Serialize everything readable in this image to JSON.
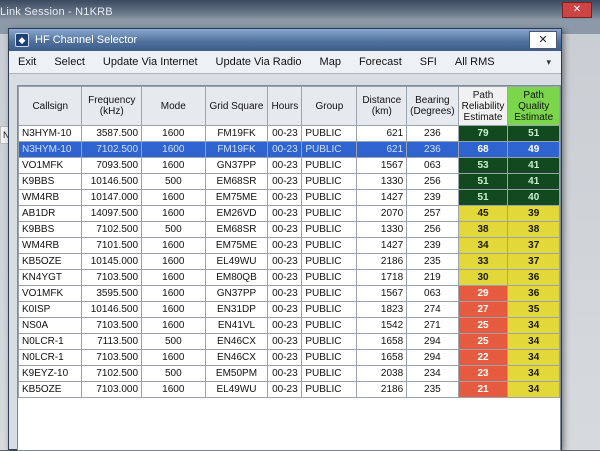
{
  "background": {
    "window_title": "Link Session - N1KRB",
    "close_glyph": "✕",
    "left_cell": "NO"
  },
  "window": {
    "title": "HF Channel Selector",
    "close_glyph": "✕",
    "menu": [
      "Exit",
      "Select",
      "Update Via Internet",
      "Update Via Radio",
      "Map",
      "Forecast",
      "SFI",
      "All RMS"
    ],
    "dropdown_icon": "▾"
  },
  "table": {
    "columns": [
      "Callsign",
      "Frequency (kHz)",
      "Mode",
      "Grid Square",
      "Hours",
      "Group",
      "Distance (km)",
      "Bearing (Degrees)",
      "Path Reliability Estimate",
      "Path Quality Estimate"
    ],
    "selected_row": 1,
    "rows": [
      [
        "N3HYM-10",
        "3587.500",
        "1600",
        "FM19FK",
        "00-23",
        "PUBLIC",
        "621",
        "236",
        "79",
        "51"
      ],
      [
        "N3HYM-10",
        "7102.500",
        "1600",
        "FM19FK",
        "00-23",
        "PUBLIC",
        "621",
        "236",
        "68",
        "49"
      ],
      [
        "VO1MFK",
        "7093.500",
        "1600",
        "GN37PP",
        "00-23",
        "PUBLIC",
        "1567",
        "063",
        "53",
        "41"
      ],
      [
        "K9BBS",
        "10146.500",
        "500",
        "EM68SR",
        "00-23",
        "PUBLIC",
        "1330",
        "256",
        "51",
        "41"
      ],
      [
        "WM4RB",
        "10147.000",
        "1600",
        "EM75ME",
        "00-23",
        "PUBLIC",
        "1427",
        "239",
        "51",
        "40"
      ],
      [
        "AB1DR",
        "14097.500",
        "1600",
        "EM26VD",
        "00-23",
        "PUBLIC",
        "2070",
        "257",
        "45",
        "39"
      ],
      [
        "K9BBS",
        "7102.500",
        "500",
        "EM68SR",
        "00-23",
        "PUBLIC",
        "1330",
        "256",
        "38",
        "38"
      ],
      [
        "WM4RB",
        "7101.500",
        "1600",
        "EM75ME",
        "00-23",
        "PUBLIC",
        "1427",
        "239",
        "34",
        "37"
      ],
      [
        "KB5OZE",
        "10145.000",
        "1600",
        "EL49WU",
        "00-23",
        "PUBLIC",
        "2186",
        "235",
        "33",
        "37"
      ],
      [
        "KN4YGT",
        "7103.500",
        "1600",
        "EM80QB",
        "00-23",
        "PUBLIC",
        "1718",
        "219",
        "30",
        "36"
      ],
      [
        "VO1MFK",
        "3595.500",
        "1600",
        "GN37PP",
        "00-23",
        "PUBLIC",
        "1567",
        "063",
        "29",
        "36"
      ],
      [
        "K0ISP",
        "10146.500",
        "1600",
        "EN31DP",
        "00-23",
        "PUBLIC",
        "1823",
        "274",
        "27",
        "35"
      ],
      [
        "NS0A",
        "7103.500",
        "1600",
        "EN41VL",
        "00-23",
        "PUBLIC",
        "1542",
        "271",
        "25",
        "34"
      ],
      [
        "N0LCR-1",
        "7113.500",
        "500",
        "EN46CX",
        "00-23",
        "PUBLIC",
        "1658",
        "294",
        "25",
        "34"
      ],
      [
        "N0LCR-1",
        "7103.500",
        "1600",
        "EN46CX",
        "00-23",
        "PUBLIC",
        "1658",
        "294",
        "22",
        "34"
      ],
      [
        "K9EYZ-10",
        "7102.500",
        "500",
        "EM50PM",
        "00-23",
        "PUBLIC",
        "2038",
        "234",
        "23",
        "34"
      ],
      [
        "KB5OZE",
        "7103.000",
        "1600",
        "EL49WU",
        "00-23",
        "PUBLIC",
        "2186",
        "235",
        "21",
        "34"
      ]
    ]
  },
  "colors": {
    "reliability_high": "#13491e",
    "reliability_mid": "#e3d83a",
    "reliability_low": "#e65a3f",
    "quality_header": "#7bd64c",
    "selection": "#2f63d0"
  }
}
